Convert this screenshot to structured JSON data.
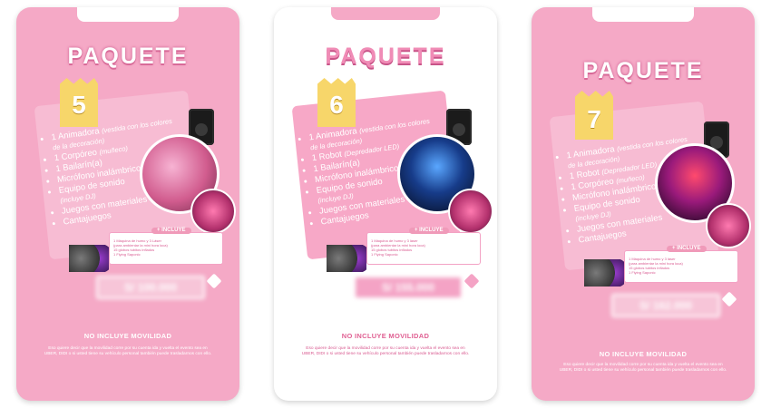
{
  "cards": [
    {
      "title": "PAQUETE",
      "number": "5",
      "features": [
        "1 Animadora",
        "(vestida con los colores de la decoración)",
        "1 Corpóreo",
        "(muñeco)",
        "1 Bailarín(a)",
        "Micrófono inalámbrico",
        "Equipo de sonido",
        "(incluye DJ)",
        "Juegos con materiales",
        "Cantajuegos"
      ],
      "incluye_label": "+ INCLUYE",
      "incluye_lines": [
        "1 Máquina de humo y 3 Láser",
        "(para ambientar la mini hora loca)",
        "15 globos tubitos inflados",
        "1 Flying Saponic"
      ],
      "price": "S/ 100.000",
      "no_movilidad": "NO INCLUYE MOVILIDAD",
      "description": "Eso quiere decir que la movilidad corre por su cuenta ida y vuelta el evento sea en UBER, DIDI o si usted tiene su vehículo personal también puede trasladarnos con ello."
    },
    {
      "title": "PAQUETE",
      "number": "6",
      "features": [
        "1 Animadora",
        "(vestida con los colores de la decoración)",
        "1 Robot",
        "(Depredador LED)",
        "1 Bailarín(a)",
        "Micrófono inalámbrico",
        "Equipo de sonido",
        "(incluye DJ)",
        "Juegos con materiales",
        "Cantajuegos"
      ],
      "incluye_label": "+ INCLUYE",
      "incluye_lines": [
        "1 Máquina de humo y 3 láser",
        "(para ambientar la mini hora loca)",
        "15 globos tubitos inflados",
        "1 Flying Saponic"
      ],
      "price": "S/ 155.000",
      "no_movilidad": "NO INCLUYE MOVILIDAD",
      "description": "Eso quiere decir que la movilidad corre por su cuenta ida y vuelta el evento sea en UBER, DIDI o si usted tiene su vehículo personal también puede trasladarnos con ello."
    },
    {
      "title": "PAQUETE",
      "number": "7",
      "features": [
        "1 Animadora",
        "(vestida con los colores de la decoración)",
        "1 Robot",
        "(Depredador LED)",
        "1 Corpóreo",
        "(muñeco)",
        "Micrófono inalámbrico",
        "Equipo de sonido",
        "(incluye DJ)",
        "Juegos con materiales",
        "Cantajuegos"
      ],
      "incluye_label": "+ INCLUYE",
      "incluye_lines": [
        "1 Máquina de humo y 3 láser",
        "(para ambientar la mini hora loca)",
        "15 globos tubitos inflados",
        "1 Flying Saponic"
      ],
      "price": "S/ 162.000",
      "no_movilidad": "NO INCLUYE MOVILIDAD",
      "description": "Eso quiere decir que la movilidad corre por su cuenta ida y vuelta el evento sea en UBER, DIDI o si usted tiene su vehículo personal también puede trasladarnos con ello."
    }
  ]
}
